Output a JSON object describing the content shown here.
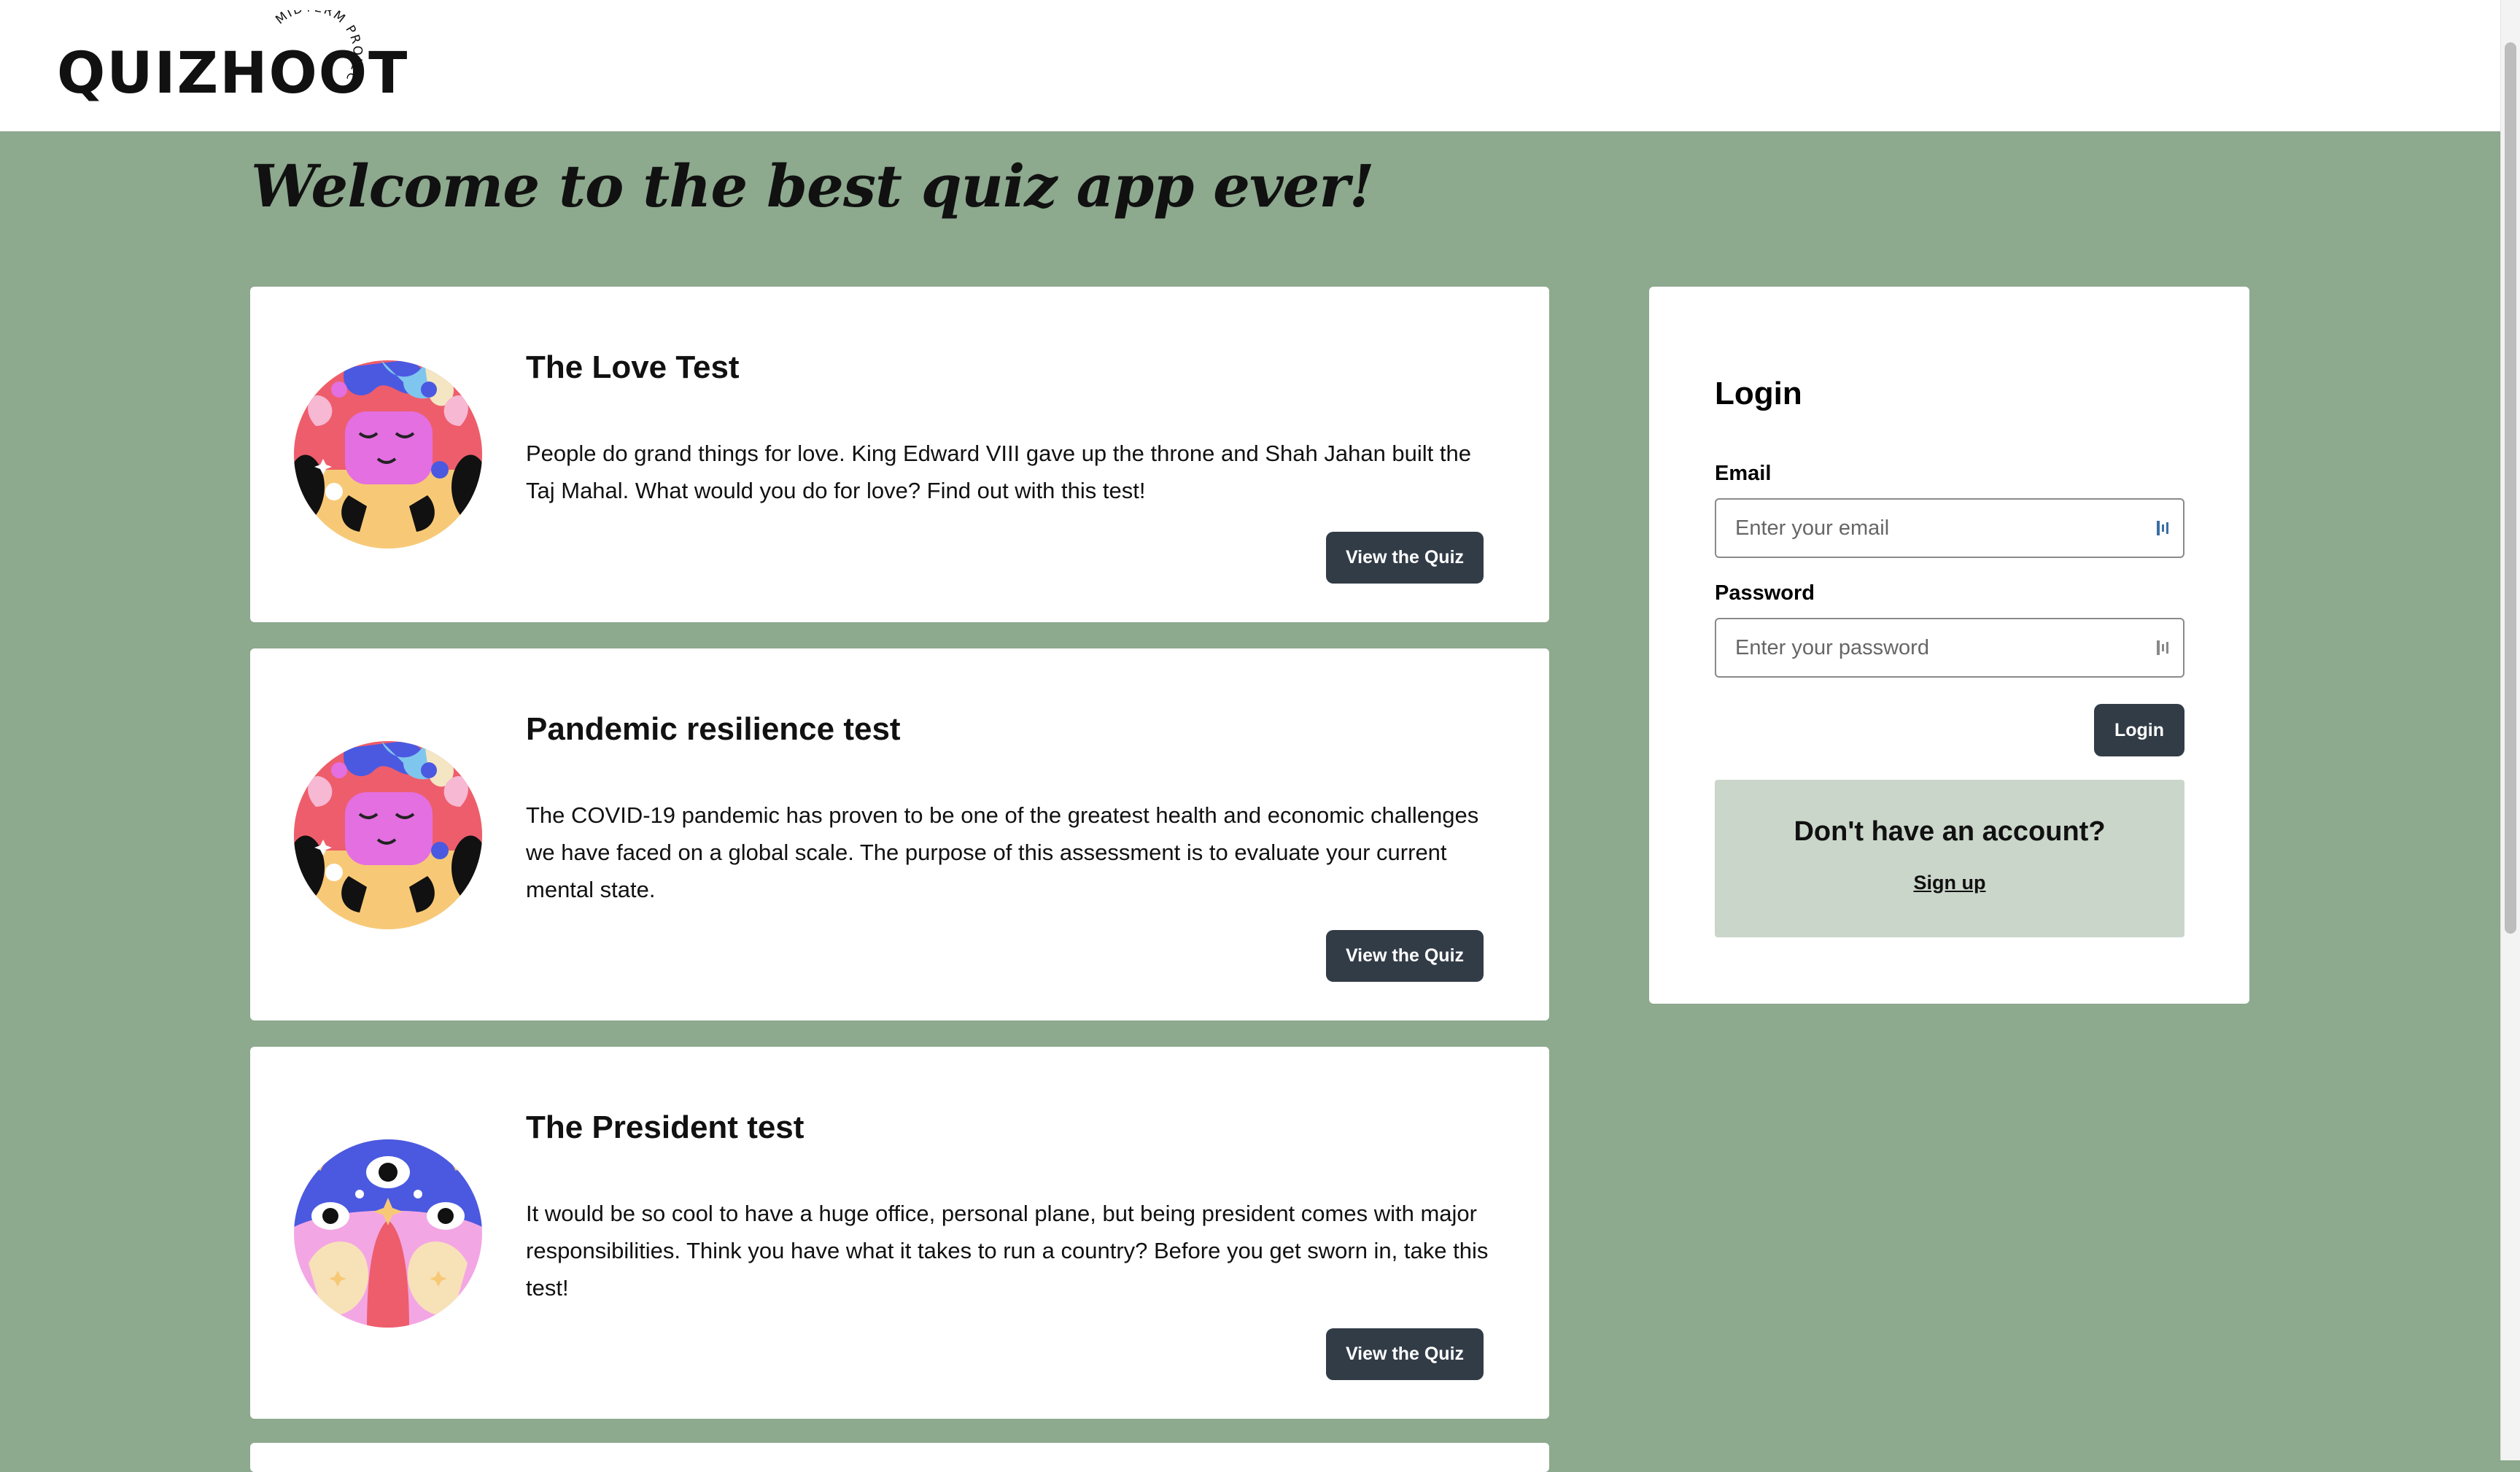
{
  "header": {
    "logo_text": "QUIZHOOT",
    "logo_tagline": "MIDTERM PROJECT"
  },
  "main": {
    "heading": "Welcome to the best quiz app ever!",
    "quizzes": [
      {
        "title": "The Love Test",
        "description": "People do grand things for love. King Edward VIII gave up the throne and Shah Jahan built the Taj Mahal. What would you do for love? Find out with this test!",
        "button_label": "View the Quiz",
        "image_icon": "meditating-face-illustration"
      },
      {
        "title": "Pandemic resilience test",
        "description": "The COVID-19 pandemic has proven to be one of the greatest health and economic challenges we have faced on a global scale. The purpose of this assessment is to evaluate your current mental state.",
        "button_label": "View the Quiz",
        "image_icon": "meditating-face-illustration"
      },
      {
        "title": "The President test",
        "description": "It would be so cool to have a huge office, personal plane, but being president comes with major responsibilities. Think you have what it takes to run a country? Before you get sworn in, take this test!",
        "button_label": "View the Quiz",
        "image_icon": "eyes-mushroom-illustration"
      }
    ]
  },
  "login": {
    "title": "Login",
    "email_label": "Email",
    "email_placeholder": "Enter your email",
    "password_label": "Password",
    "password_placeholder": "Enter your password",
    "button_label": "Login",
    "no_account_text": "Don't have an account?",
    "signup_link": "Sign up"
  },
  "colors": {
    "page_background": "#8da98e",
    "button": "#323c47",
    "signup_panel": "#cbd6cb"
  }
}
